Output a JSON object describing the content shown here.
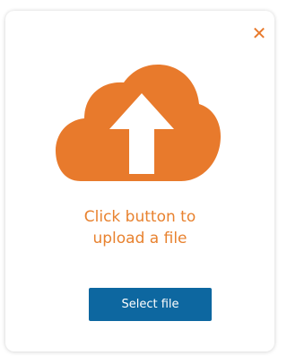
{
  "dialog": {
    "close_label": "✕",
    "icon": "cloud-upload-icon",
    "message_line1": "Click button to",
    "message_line2": "upload a file",
    "select_button_label": "Select file"
  },
  "colors": {
    "accent": "#e87a2c",
    "button_bg": "#0d67a0",
    "button_text": "#ffffff"
  }
}
